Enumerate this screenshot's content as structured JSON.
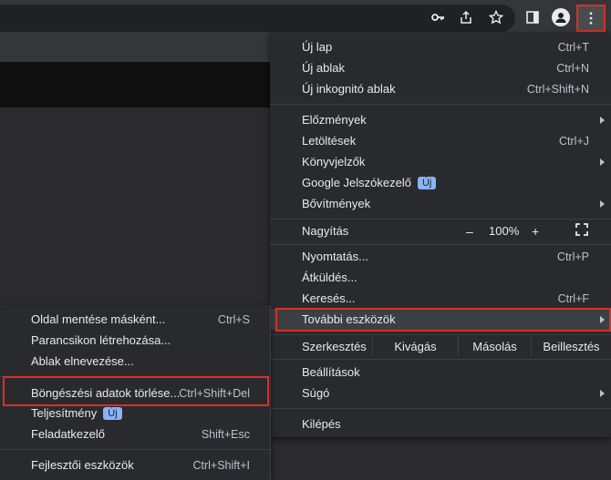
{
  "colors": {
    "highlight": "#d93025",
    "badge": "#8ab4f8",
    "menu_bg": "#292a2d"
  },
  "toolbar": {
    "icons": [
      "key-icon",
      "share-icon",
      "star-icon",
      "side-panel-icon",
      "profile-icon",
      "kebab-menu-icon"
    ]
  },
  "main_menu": {
    "items": [
      {
        "label": "Új lap",
        "shortcut": "Ctrl+T"
      },
      {
        "label": "Új ablak",
        "shortcut": "Ctrl+N"
      },
      {
        "label": "Új inkognitó ablak",
        "shortcut": "Ctrl+Shift+N"
      },
      {
        "label": "Előzmények",
        "shortcut": ""
      },
      {
        "label": "Letöltések",
        "shortcut": "Ctrl+J"
      },
      {
        "label": "Könyvjelzők",
        "shortcut": ""
      },
      {
        "label": "Google Jelszókezelő",
        "badge": "Új"
      },
      {
        "label": "Bővítmények",
        "shortcut": ""
      },
      {
        "label": "Nyomtatás...",
        "shortcut": "Ctrl+P"
      },
      {
        "label": "Átküldés...",
        "shortcut": ""
      },
      {
        "label": "Keresés...",
        "shortcut": "Ctrl+F"
      },
      {
        "label": "További eszközök",
        "shortcut": ""
      },
      {
        "label": "Beállítások",
        "shortcut": ""
      },
      {
        "label": "Súgó",
        "shortcut": ""
      },
      {
        "label": "Kilépés",
        "shortcut": ""
      }
    ],
    "zoom": {
      "label": "Nagyítás",
      "minus": "–",
      "value": "100%",
      "plus": "+"
    },
    "edit": {
      "label": "Szerkesztés",
      "cut": "Kivágás",
      "copy": "Másolás",
      "paste": "Beillesztés"
    }
  },
  "sub_menu": {
    "items": [
      {
        "label": "Oldal mentése másként...",
        "shortcut": "Ctrl+S"
      },
      {
        "label": "Parancsikon létrehozása...",
        "shortcut": ""
      },
      {
        "label": "Ablak elnevezése...",
        "shortcut": ""
      },
      {
        "label": "Böngészési adatok törlése...",
        "shortcut": "Ctrl+Shift+Del"
      },
      {
        "label": "Teljesítmény",
        "badge": "Új"
      },
      {
        "label": "Feladatkezelő",
        "shortcut": "Shift+Esc"
      },
      {
        "label": "Fejlesztői eszközök",
        "shortcut": "Ctrl+Shift+I"
      }
    ]
  }
}
